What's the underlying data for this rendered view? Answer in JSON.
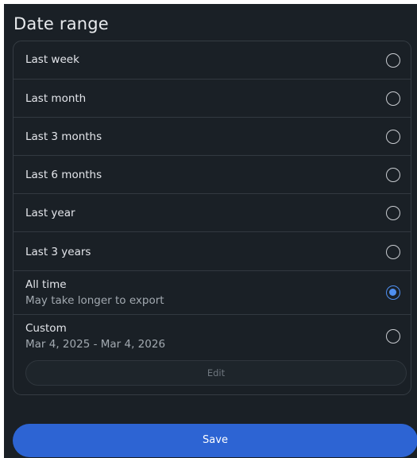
{
  "dialog": {
    "title": "Date range"
  },
  "options": [
    {
      "label": "Last week",
      "selected": false
    },
    {
      "label": "Last month",
      "selected": false
    },
    {
      "label": "Last 3 months",
      "selected": false
    },
    {
      "label": "Last 6 months",
      "selected": false
    },
    {
      "label": "Last year",
      "selected": false
    },
    {
      "label": "Last 3 years",
      "selected": false
    },
    {
      "label": "All time",
      "sublabel": "May take longer to export",
      "selected": true
    },
    {
      "label": "Custom",
      "sublabel": "Mar 4, 2025 - Mar 4, 2026",
      "selected": false,
      "edit_label": "Edit"
    }
  ],
  "footer": {
    "save_label": "Save"
  },
  "colors": {
    "background": "#1a2026",
    "accent": "#4f8ff0",
    "save_button": "#2d64d3"
  }
}
